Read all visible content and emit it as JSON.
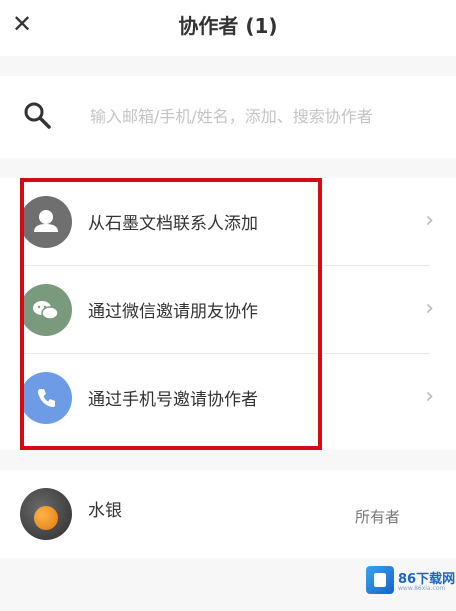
{
  "header": {
    "close_glyph": "✕",
    "title": "协作者 (1)"
  },
  "search": {
    "icon": "search-icon",
    "placeholder": "输入邮箱/手机/姓名，添加、搜索协作者"
  },
  "menu": {
    "items": [
      {
        "label": "从石墨文档联系人添加",
        "icon": "person-icon",
        "color": "#6f6f6f"
      },
      {
        "label": "通过微信邀请朋友协作",
        "icon": "wechat-icon",
        "color": "#7a9a7e"
      },
      {
        "label": "通过手机号邀请协作者",
        "icon": "phone-icon",
        "color": "#6e9be6"
      }
    ],
    "chevron": "›"
  },
  "highlight_color": "#d40b14",
  "member": {
    "name": "水银",
    "role": "所有者"
  },
  "watermark": {
    "brand": "86下载网",
    "url": "www.86xia.com"
  }
}
